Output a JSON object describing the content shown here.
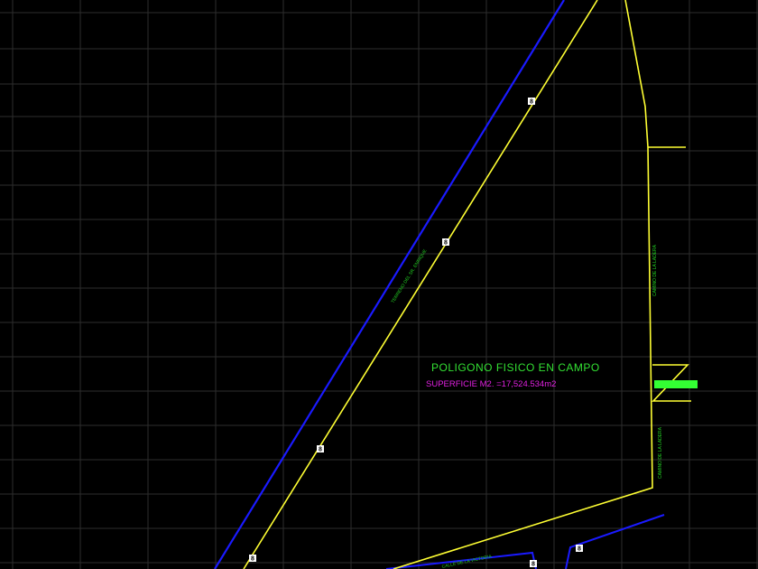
{
  "drawing": {
    "title": "POLIGONO FISICO EN CAMPO",
    "area_label": "SUPERFICIE M2. =17,524.534m2",
    "colors": {
      "background": "#000000",
      "grid": "#2e2e2e",
      "boundary": "#ffff33",
      "blue_road": "#1a1aff",
      "title": "#33e033",
      "area": "#e020e0",
      "marker_fill": "#ffffff",
      "marker_accent": "#33ff33",
      "label": "#22cc22"
    },
    "markers": [
      "8",
      "8",
      "8",
      "8",
      "8",
      "8"
    ],
    "road_labels": {
      "diagonal": "TERRENO DEL SR. ENRIQUE",
      "right_upper": "CAMINO DE LA LADERA",
      "right_lower": "CAMINO DE LA LADERA",
      "bottom": "CALLE DE LA VICTORIA"
    }
  }
}
